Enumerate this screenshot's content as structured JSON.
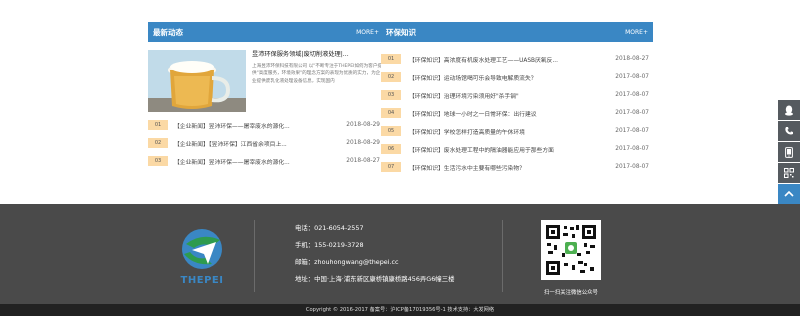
{
  "left_panel": {
    "title": "最新动态",
    "more": "MORE+",
    "feature": {
      "title": "昱沛环保服务领域|废切削液处理|...",
      "desc": "上海昱沛环保科技有限公司 以\"不断专注于THEPEI如何为客户提供\"高度服务，环境效果\"的理念方案的表现为优质的实力，为企业提供废乳化液处理设备信息，实现国内"
    },
    "items": [
      {
        "num": "01",
        "text": "【企业新闻】昱沛环保——屠宰废水的源化...",
        "date": "2018-08-29"
      },
      {
        "num": "02",
        "text": "【企业新闻】【昱沛环保】江西省余项目上...",
        "date": "2018-08-29"
      },
      {
        "num": "03",
        "text": "【企业新闻】昱沛环保——屠宰废水的源化...",
        "date": "2018-08-27"
      }
    ]
  },
  "right_panel": {
    "title": "环保知识",
    "more": "MORE+",
    "items": [
      {
        "num": "01",
        "text": "【环保知识】高浓度有机废水处理工艺——UASB厌氧反...",
        "date": "2018-08-27"
      },
      {
        "num": "02",
        "text": "【环保知识】运动场馆喝可乐会导致电解质流失？",
        "date": "2017-08-07"
      },
      {
        "num": "03",
        "text": "【环保知识】治理环境污染须用好\"杀手锏\"",
        "date": "2017-08-07"
      },
      {
        "num": "04",
        "text": "【环保知识】地球一小时之一日常环保：出行建议",
        "date": "2017-08-07"
      },
      {
        "num": "05",
        "text": "【环保知识】学校怎样打造高质量的午休环境",
        "date": "2017-08-07"
      },
      {
        "num": "06",
        "text": "【环保知识】废水处理工程中的隔油器能应用于那些方面",
        "date": "2017-08-07"
      },
      {
        "num": "07",
        "text": "【环保知识】生活污水中主要有哪些污染物？",
        "date": "2017-08-07"
      }
    ]
  },
  "sidebar": {
    "icons": [
      "qq-icon",
      "phone-icon",
      "mobile-icon",
      "qrcode-icon",
      "back-to-top-icon"
    ]
  },
  "footer": {
    "logo_text": "THEPEI",
    "phone": "电话：021-6054-2557",
    "mobile": "手机：155-0219-3728",
    "email": "邮箱：zhouhongwang@thepei.cc",
    "address": "地址：中国·上海·浦东新区康桥镇康桥路456弄G6幢三楼",
    "qr_caption": "扫一扫关注微信公众号",
    "copyright": "Copyright © 2016-2017   备案号：沪ICP备17019356号-1   技术支持：大发网络"
  },
  "colors": {
    "accent": "#3a87c4",
    "number_badge": "#fbd9a5",
    "footer_bg": "#4a4a4a",
    "copyright_bg": "#222222",
    "sidebar_bg": "#555a5f"
  }
}
